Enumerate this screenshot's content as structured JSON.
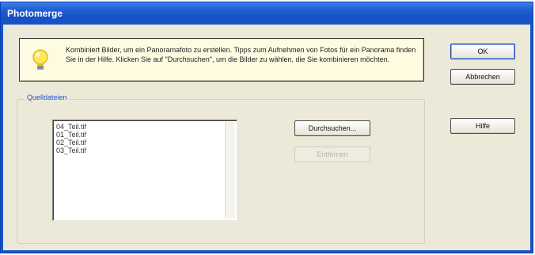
{
  "window": {
    "title": "Photomerge"
  },
  "info": {
    "icon": "lightbulb-icon",
    "text": "Kombiniert Bilder, um ein Panoramafoto zu erstellen. Tipps zum Aufnehmen von Fotos für ein Panorama finden Sie in der Hilfe. Klicken Sie auf \"Durchsuchen\", um die Bilder zu wählen, die Sie kombinieren möchten."
  },
  "source_group": {
    "label": "Quelldateien",
    "files": [
      "04_Teil.tif",
      "01_Teil.tif",
      "02_Teil.tif",
      "03_Teil.tif"
    ]
  },
  "buttons": {
    "browse": "Durchsuchen...",
    "remove": "Entfernen",
    "ok": "OK",
    "cancel": "Abbrechen",
    "help": "Hilfe"
  },
  "colors": {
    "title_bar": "#1f5fd2",
    "dialog_bg": "#ece9d8",
    "info_bg": "#fefbe0",
    "group_label": "#1f55c4"
  }
}
